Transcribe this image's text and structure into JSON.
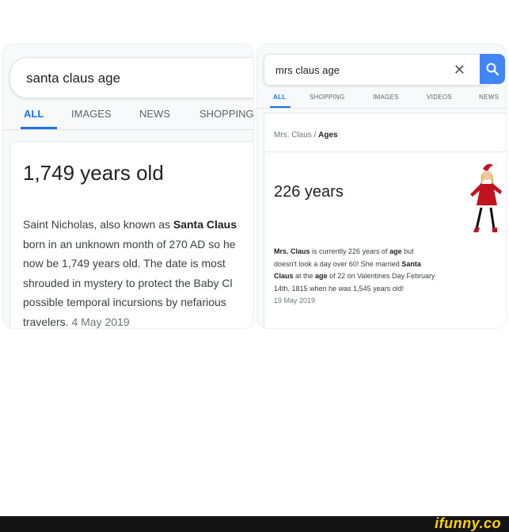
{
  "left": {
    "query": "santa claus age",
    "tabs": [
      "ALL",
      "IMAGES",
      "NEWS",
      "SHOPPING"
    ],
    "answer": "1,749 years old",
    "snippet": {
      "l1_pre": "Saint Nicholas, also known as ",
      "l1_bold": "Santa Claus",
      "l2": "born in an unknown month of 270 AD so he",
      "l3": "now be 1,749 years old. The date is most",
      "l4": "shrouded in mystery to protect the Baby Cl",
      "l5": "possible temporal incursions by nefarious",
      "l6": "travelers.",
      "date": "4 May 2019"
    }
  },
  "right": {
    "query": "mrs claus age",
    "close_glyph": "✕",
    "tabs": [
      "ALL",
      "SHOPPING",
      "IMAGES",
      "VIDEOS",
      "NEWS"
    ],
    "breadcrumb": {
      "a": "Mrs. Claus",
      "sep": "/",
      "b": "Ages"
    },
    "answer": "226 years",
    "snippet": {
      "l1_b1": "Mrs. Claus",
      "l1_t1": " is currently 226 years of ",
      "l1_b2": "age",
      "l1_t2": " but",
      "l2_t1": "doesn't look a day over 60! She married ",
      "l2_b1": "Santa",
      "l3_b1": "Claus",
      "l3_t1": " at the ",
      "l3_b2": "age",
      "l3_t2": " of 22 on Valentines Day February",
      "l4": "14th, 1815 when he was 1,545 years old!",
      "date": "19 May 2019"
    }
  },
  "footer": {
    "brand": "ifunny.co"
  },
  "colors": {
    "accent": "#1a73e8",
    "search_button": "#4285f4",
    "brand": "#ffd400"
  }
}
